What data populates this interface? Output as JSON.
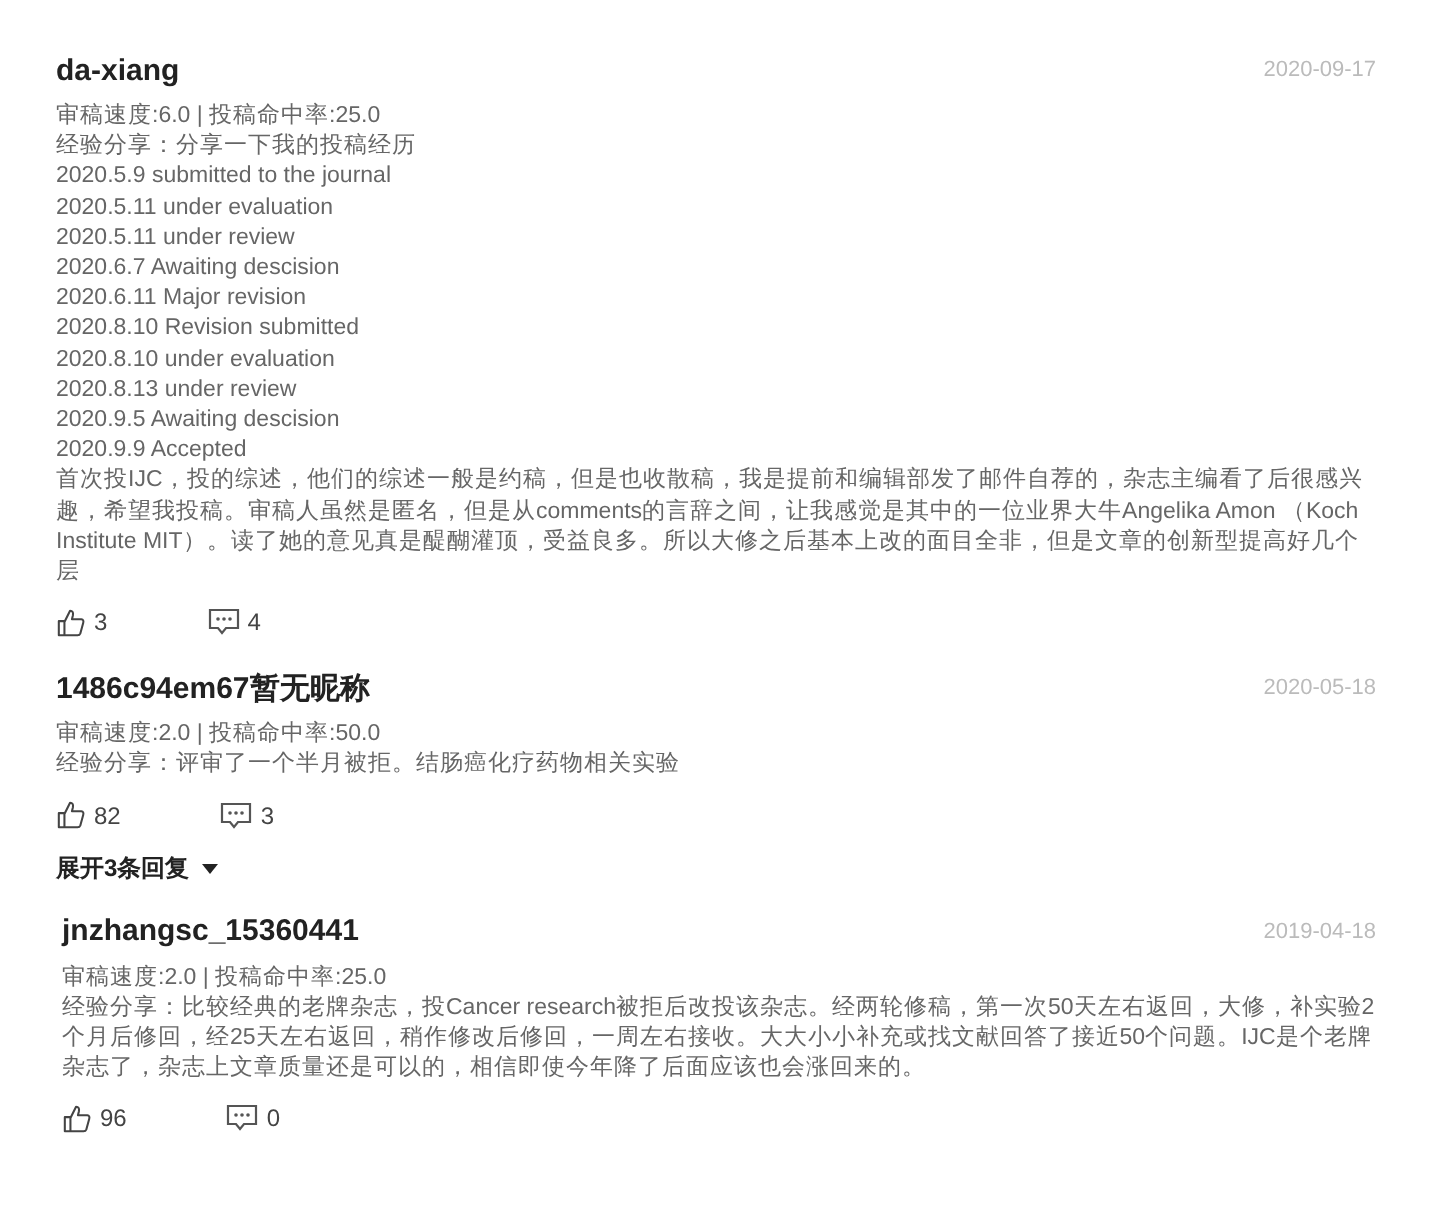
{
  "reviews": [
    {
      "name": "da-xiang",
      "date": "2020-09-17",
      "stats": "审稿速度:6.0 | 投稿命中率:25.0",
      "lines": [
        "经验分享：分享一下我的投稿经历",
        "2020.5.9 submitted to the journal",
        "2020.5.11 under evaluation",
        "2020.5.11 under review",
        "2020.6.7 Awaiting descision",
        "2020.6.11 Major revision",
        "2020.8.10 Revision submitted",
        "2020.8.10 under evaluation",
        "2020.8.13 under review",
        "2020.9.5 Awaiting descision",
        "2020.9.9 Accepted",
        "首次投IJC，投的综述，他们的综述一般是约稿，但是也收散稿，我是提前和编辑部发了邮件自荐的，杂志主编看了后很感兴趣，希望我投稿。审稿人虽然是匿名，但是从comments的言辞之间，让我感觉是其中的一位业界大牛Angelika Amon （Koch Institute MIT）。读了她的意见真是醍醐灌顶，受益良多。所以大修之后基本上改的面目全非，但是文章的创新型提高好几个层"
      ],
      "likes": "3",
      "comments": "4"
    },
    {
      "name": "1486c94em67暂无昵称",
      "date": "2020-05-18",
      "stats": "审稿速度:2.0 | 投稿命中率:50.0",
      "lines": [
        "经验分享：评审了一个半月被拒。结肠癌化疗药物相关实验"
      ],
      "likes": "82",
      "comments": "3",
      "expand": "展开3条回复"
    },
    {
      "name": "jnzhangsc_15360441",
      "date": "2019-04-18",
      "stats": "审稿速度:2.0 | 投稿命中率:25.0",
      "lines": [
        "经验分享：比较经典的老牌杂志，投Cancer research被拒后改投该杂志。经两轮修稿，第一次50天左右返回，大修，补实验2个月后修回，经25天左右返回，稍作修改后修回，一周左右接收。大大小小补充或找文献回答了接近50个问题。IJC是个老牌杂志了，杂志上文章质量还是可以的，相信即使今年降了后面应该也会涨回来的。"
      ],
      "likes": "96",
      "comments": "0"
    }
  ]
}
